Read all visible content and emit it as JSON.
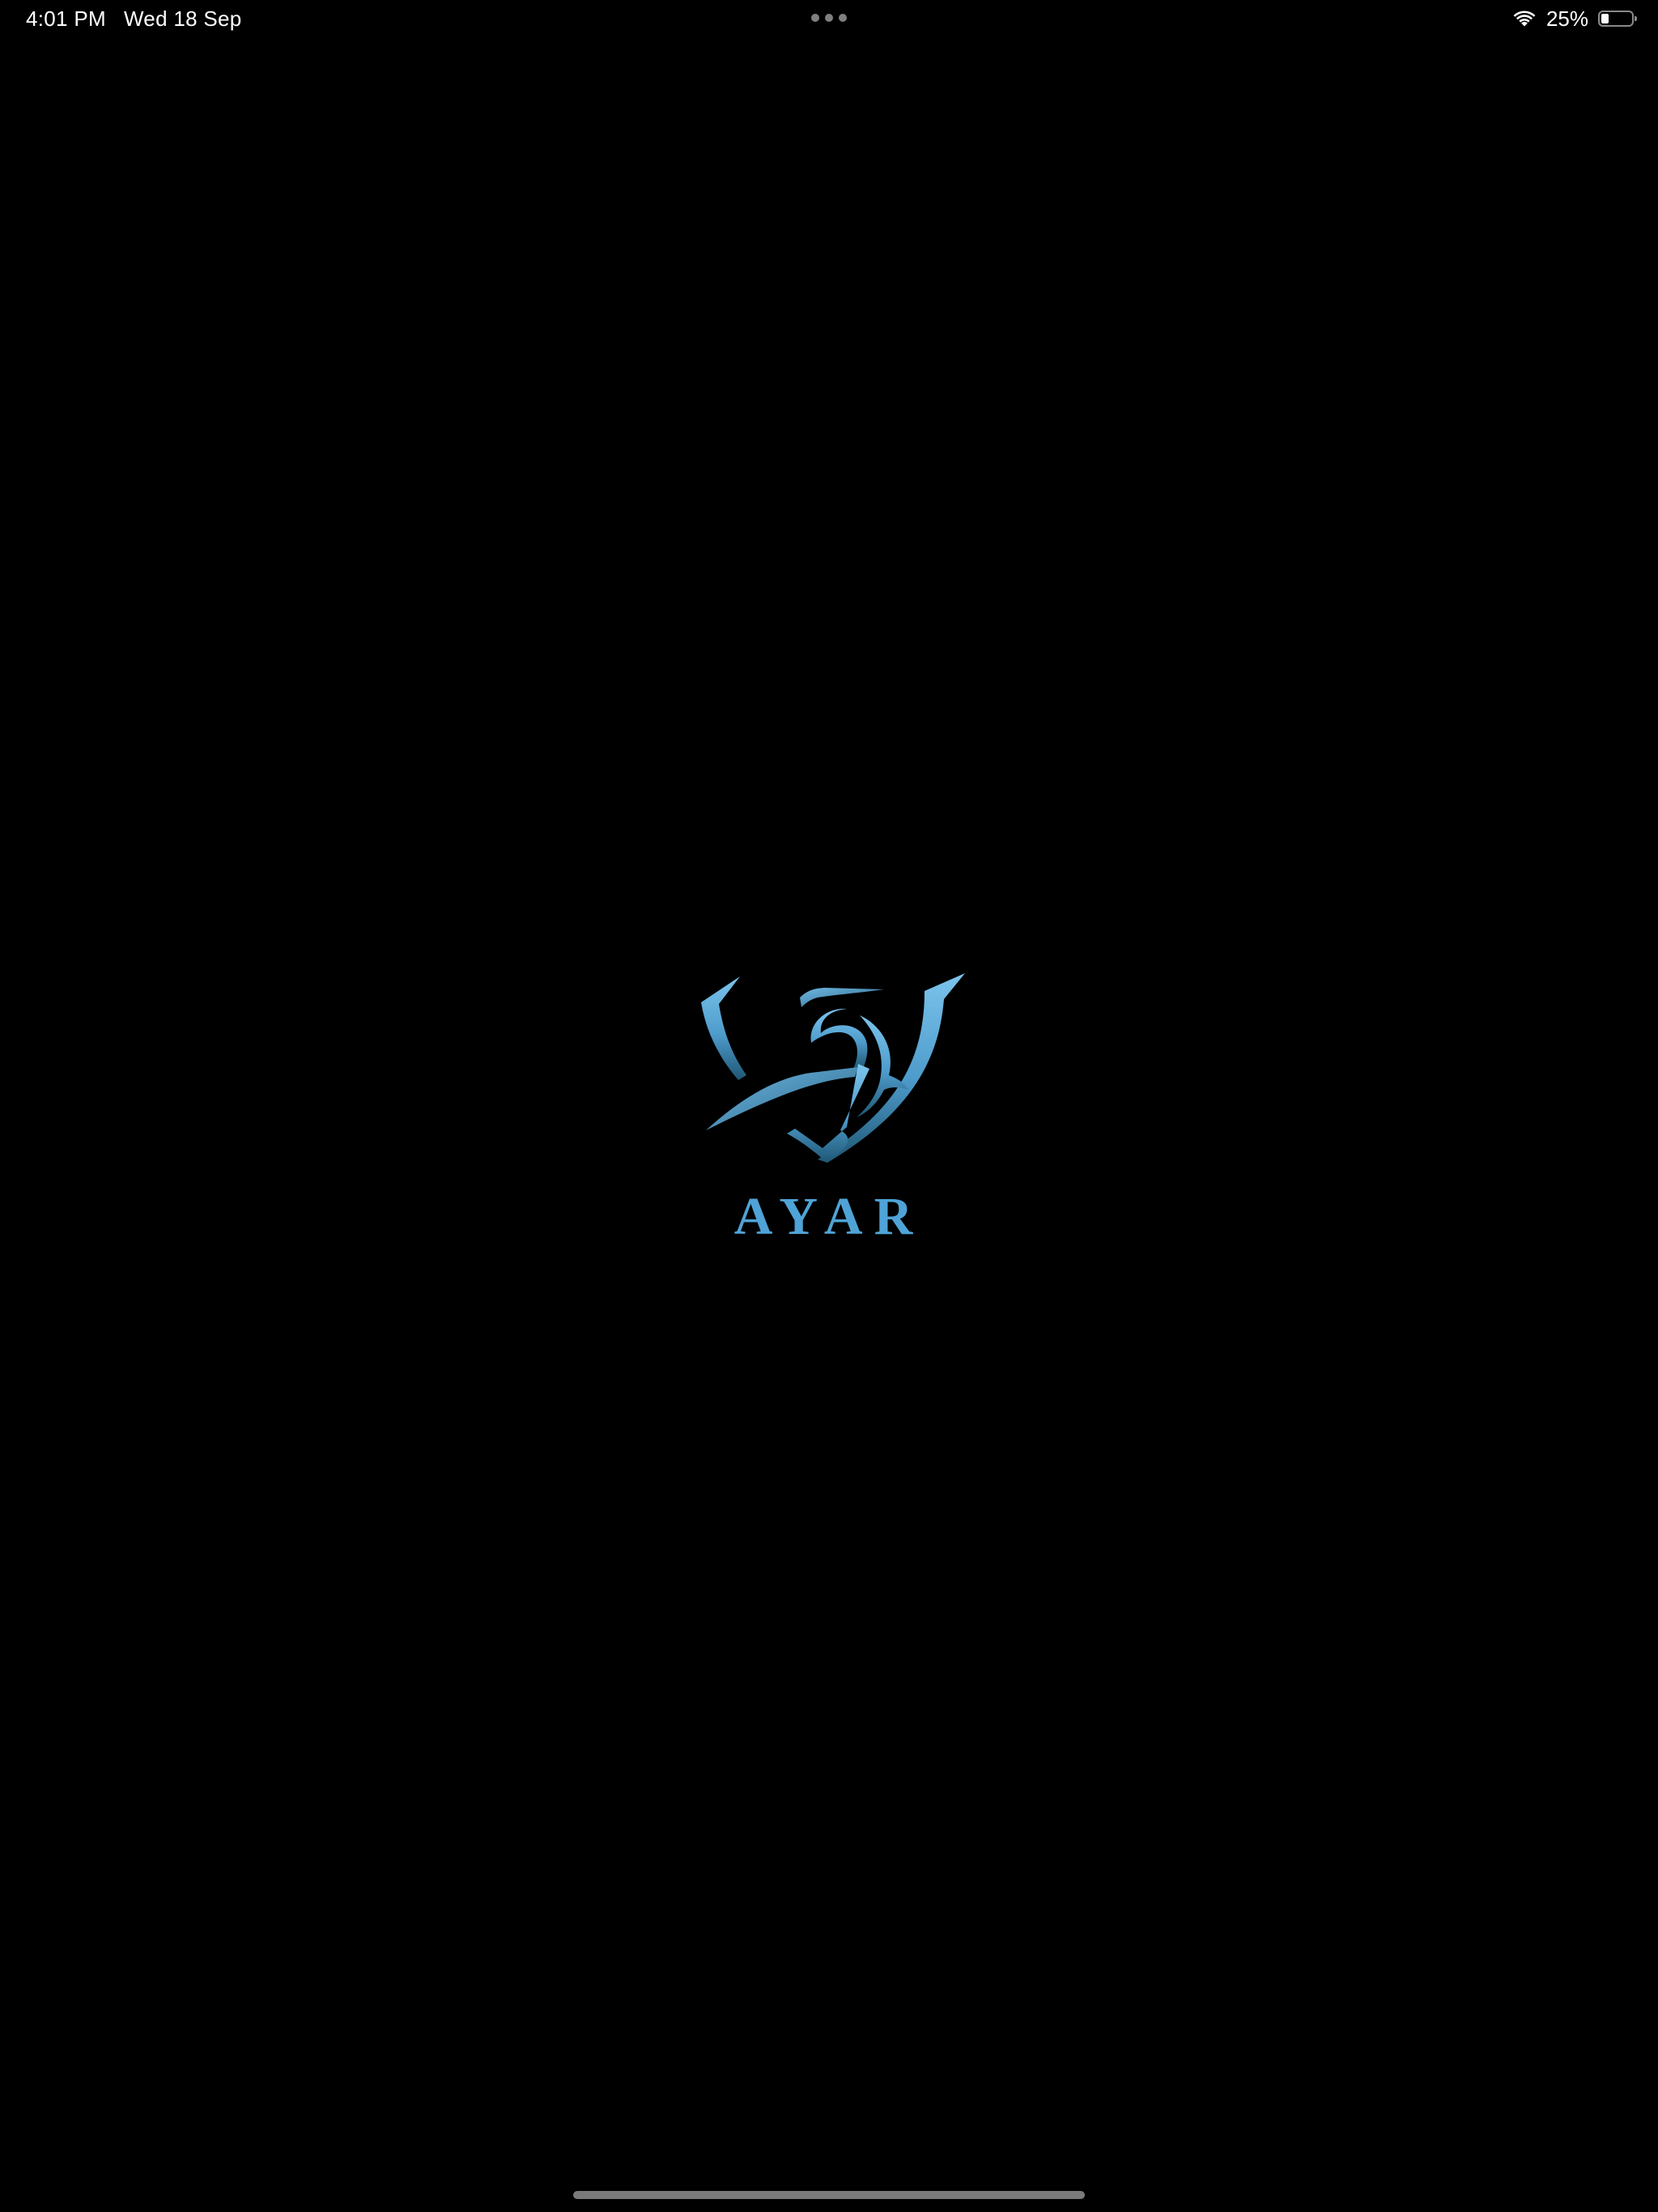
{
  "status_bar": {
    "time": "4:01 PM",
    "date": "Wed 18 Sep",
    "battery_text": "25%",
    "battery_level": 0.25,
    "icons": [
      "wifi-icon",
      "battery-icon",
      "multitask-dots-icon"
    ]
  },
  "splash": {
    "brand_name": "AYAR",
    "logo_icon": "ayar-shield-logo",
    "accent_color": "#4fa3d6",
    "background_color": "#000000"
  }
}
